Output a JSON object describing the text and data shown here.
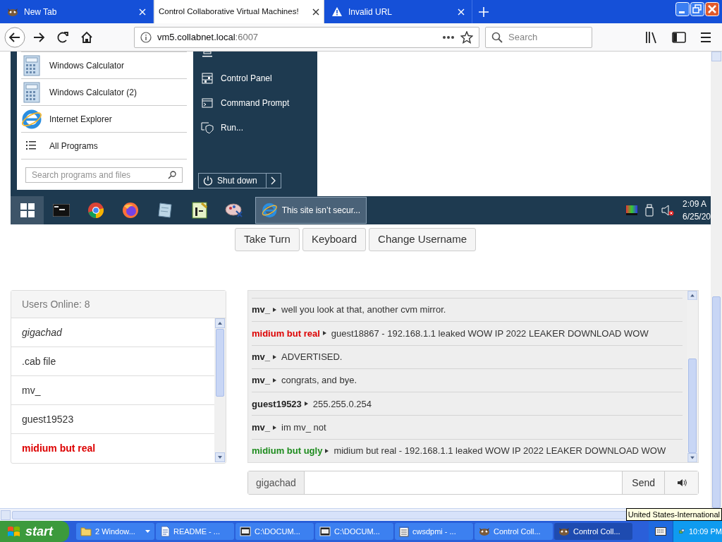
{
  "browser": {
    "tabs": [
      {
        "title": "New Tab",
        "kind": "animal",
        "selected": false
      },
      {
        "title": "Control Collaborative Virtual Machines!",
        "kind": "plain",
        "selected": true
      },
      {
        "title": "Invalid URL",
        "kind": "warning",
        "selected": false
      }
    ],
    "url": {
      "host": "vm5.collabnet.local",
      "port": ":6007"
    },
    "search_placeholder": "Search"
  },
  "vm": {
    "start_menu": {
      "programs": [
        {
          "label": "Windows Calculator",
          "kind": "calculator"
        },
        {
          "label": "Windows Calculator (2)",
          "kind": "calculator"
        },
        {
          "label": "Internet Explorer",
          "kind": "browser"
        },
        {
          "label": "All Programs",
          "kind": "list"
        }
      ],
      "search_placeholder": "Search programs and files",
      "places": [
        {
          "label": "Control Panel",
          "kind": "panel"
        },
        {
          "label": "Command Prompt",
          "kind": "terminal"
        },
        {
          "label": "Run...",
          "kind": "run"
        }
      ],
      "shutdown": "Shut down"
    },
    "taskbar": {
      "pinned": [
        {
          "kind": "terminal"
        },
        {
          "kind": "chrome"
        },
        {
          "kind": "firefox"
        },
        {
          "kind": "notepad"
        },
        {
          "kind": "chart"
        },
        {
          "kind": "paint"
        }
      ],
      "window": {
        "label": "This site isn’t secur..."
      },
      "time": "2:09 A",
      "date": "6/25/20"
    }
  },
  "controls": [
    "Take Turn",
    "Keyboard",
    "Change Username"
  ],
  "users": {
    "title": "Users Online: 8",
    "items": [
      {
        "name": "gigachad",
        "italic": true,
        "color": "#333333"
      },
      {
        "name": ".cab file",
        "italic": false,
        "color": "#333333"
      },
      {
        "name": "mv_",
        "italic": false,
        "color": "#333333"
      },
      {
        "name": "guest19523",
        "italic": false,
        "color": "#333333"
      },
      {
        "name": "midium but real",
        "italic": false,
        "color": "#dd0000"
      }
    ]
  },
  "chat": {
    "messages": [
      {
        "user": "mv_",
        "color": "#222222",
        "text": "well you look at that, another cvm mirror."
      },
      {
        "user": "midium but real",
        "color": "#dd0000",
        "text": "guest18867 - 192.168.1.1 leaked WOW IP 2022 LEAKER DOWNLOAD WOW"
      },
      {
        "user": "mv_",
        "color": "#222222",
        "text": "ADVERTISED."
      },
      {
        "user": "mv_",
        "color": "#222222",
        "text": "congrats, and bye."
      },
      {
        "user": "guest19523",
        "color": "#222222",
        "text": "255.255.0.254"
      },
      {
        "user": "mv_",
        "color": "#222222",
        "text": "im mv_ not"
      },
      {
        "user": "midium but ugly",
        "color": "#1e8c1e",
        "text": "midium but real - 192.168.1.1 leaked WOW IP 2022 LEAKER DOWNLOAD WOW"
      }
    ],
    "username": "gigachad",
    "send": "Send"
  },
  "tooltip": "United States-International",
  "xp_taskbar": {
    "start": "start",
    "items": [
      {
        "label": "2 Window...",
        "kind": "folder",
        "grouped": true,
        "selected": false
      },
      {
        "label": "README - ...",
        "kind": "document",
        "grouped": false,
        "selected": false
      },
      {
        "label": "C:\\DOCUM...",
        "kind": "archive",
        "grouped": false,
        "selected": false
      },
      {
        "label": "C:\\DOCUM...",
        "kind": "archive",
        "grouped": false,
        "selected": false
      },
      {
        "label": "cwsdpmi - ...",
        "kind": "notepad",
        "grouped": false,
        "selected": false
      },
      {
        "label": "Control Coll...",
        "kind": "animal",
        "grouped": false,
        "selected": false
      },
      {
        "label": "Control Coll...",
        "kind": "animal",
        "grouped": false,
        "selected": true
      }
    ],
    "time": "10:09 PM"
  }
}
